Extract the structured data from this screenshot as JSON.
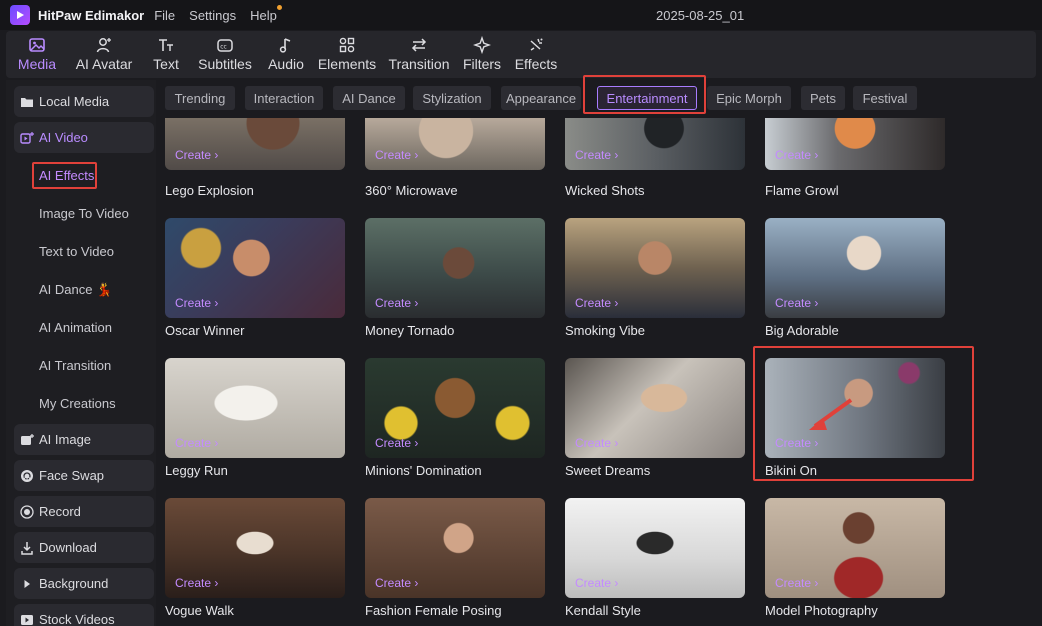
{
  "app": {
    "name": "HitPaw Edimakor",
    "project_title": "2025-08-25_01"
  },
  "menu": [
    "File",
    "Settings",
    "Help"
  ],
  "toolbar": [
    {
      "label": "Media",
      "icon": "media-icon",
      "active": true
    },
    {
      "label": "AI Avatar",
      "icon": "ai-avatar-icon"
    },
    {
      "label": "Text",
      "icon": "text-icon"
    },
    {
      "label": "Subtitles",
      "icon": "subtitles-icon"
    },
    {
      "label": "Audio",
      "icon": "audio-icon"
    },
    {
      "label": "Elements",
      "icon": "elements-icon"
    },
    {
      "label": "Transition",
      "icon": "transition-icon"
    },
    {
      "label": "Filters",
      "icon": "filters-icon"
    },
    {
      "label": "Effects",
      "icon": "effects-icon"
    }
  ],
  "sidebar": {
    "groups": [
      {
        "label": "Local Media",
        "icon": "folder-icon"
      },
      {
        "label": "AI Video",
        "icon": "ai-video-icon",
        "active": true
      },
      {
        "label": "AI Image",
        "icon": "ai-image-icon"
      },
      {
        "label": "Face Swap",
        "icon": "face-swap-icon"
      },
      {
        "label": "Record",
        "icon": "record-icon"
      },
      {
        "label": "Download",
        "icon": "download-icon"
      },
      {
        "label": "Background",
        "icon": "background-icon"
      },
      {
        "label": "Stock Videos",
        "icon": "stock-videos-icon"
      }
    ],
    "ai_video_items": [
      {
        "label": "AI Effects",
        "active": true
      },
      {
        "label": "Image To Video"
      },
      {
        "label": "Text to Video"
      },
      {
        "label": "AI Dance 💃"
      },
      {
        "label": "AI Animation"
      },
      {
        "label": "AI Transition"
      },
      {
        "label": "My Creations"
      }
    ]
  },
  "categories": [
    {
      "label": "Trending"
    },
    {
      "label": "Interaction"
    },
    {
      "label": "AI Dance"
    },
    {
      "label": "Stylization"
    },
    {
      "label": "Appearance"
    },
    {
      "label": "Entertainment",
      "active": true
    },
    {
      "label": "Epic Morph"
    },
    {
      "label": "Pets"
    },
    {
      "label": "Festival"
    }
  ],
  "create_label": "Create ›",
  "effects": [
    {
      "title": "Lego Explosion"
    },
    {
      "title": "360° Microwave"
    },
    {
      "title": "Wicked Shots"
    },
    {
      "title": "Flame Growl"
    },
    {
      "title": "Oscar Winner"
    },
    {
      "title": "Money Tornado"
    },
    {
      "title": "Smoking Vibe"
    },
    {
      "title": "Big Adorable"
    },
    {
      "title": "Leggy Run"
    },
    {
      "title": "Minions' Domination"
    },
    {
      "title": "Sweet Dreams"
    },
    {
      "title": "Bikini On",
      "highlighted": true
    },
    {
      "title": "Vogue Walk"
    },
    {
      "title": "Fashion Female Posing"
    },
    {
      "title": "Kendall Style"
    },
    {
      "title": "Model Photography"
    }
  ],
  "colors": {
    "accent": "#b98cff",
    "highlight": "#e0413a",
    "background": "#1b1b1f"
  }
}
